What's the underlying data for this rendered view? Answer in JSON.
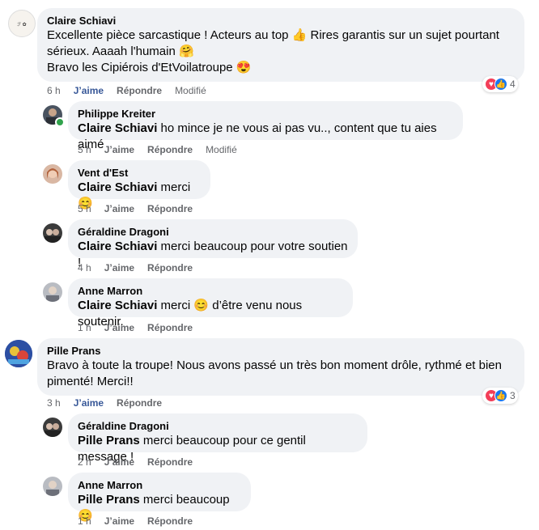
{
  "comments": [
    {
      "author": "Claire Schiavi",
      "lines": [
        "Excellente pièce sarcastique ! Acteurs au top 👍 Rires garantis sur un sujet pourtant",
        "sérieux. Aaaah l'humain 🤗",
        "Bravo les Cipiérois d'EtVoilatroupe 😍"
      ],
      "time": "6 h",
      "like": "J’aime",
      "reply": "Répondre",
      "modified": "Modifié",
      "reaction_count": "4",
      "replies": [
        {
          "author": "Philippe Kreiter",
          "mention": "Claire Schiavi",
          "text": " ho mince je ne vous ai pas vu.., content que tu aies aimé",
          "time": "5 h",
          "like": "J’aime",
          "reply": "Répondre",
          "modified": "Modifié"
        },
        {
          "author": "Vent d'Est",
          "mention": "Claire Schiavi",
          "text": " merci 😊",
          "time": "5 h",
          "like": "J’aime",
          "reply": "Répondre"
        },
        {
          "author": "Géraldine Dragoni",
          "mention": "Claire Schiavi",
          "text": " merci beaucoup pour votre soutien !",
          "time": "4 h",
          "like": "J’aime",
          "reply": "Répondre"
        },
        {
          "author": "Anne Marron",
          "mention": "Claire Schiavi",
          "text": " merci 😊 d’être venu nous soutenir.",
          "time": "1 h",
          "like": "J’aime",
          "reply": "Répondre"
        }
      ]
    },
    {
      "author": "Pille Prans",
      "lines": [
        "Bravo à toute la troupe! Nous avons passé un très bon moment drôle, rythmé et bien",
        "pimenté! Merci!!"
      ],
      "time": "3 h",
      "like": "J’aime",
      "reply": "Répondre",
      "reaction_count": "3",
      "replies": [
        {
          "author": "Géraldine Dragoni",
          "mention": "Pille Prans",
          "text": " merci beaucoup pour ce gentil message !",
          "time": "2 h",
          "like": "J’aime",
          "reply": "Répondre"
        },
        {
          "author": "Anne Marron",
          "mention": "Pille Prans",
          "text": " merci beaucoup 😊",
          "time": "1 h",
          "like": "J’aime",
          "reply": "Répondre"
        }
      ]
    }
  ],
  "icons": {
    "love": "heart-icon",
    "like": "thumbs-up-icon"
  },
  "colors": {
    "bubble": "#f0f2f5",
    "liked": "#385898",
    "meta": "#65676b",
    "love": "#f33e58",
    "like": "#1877f2"
  }
}
